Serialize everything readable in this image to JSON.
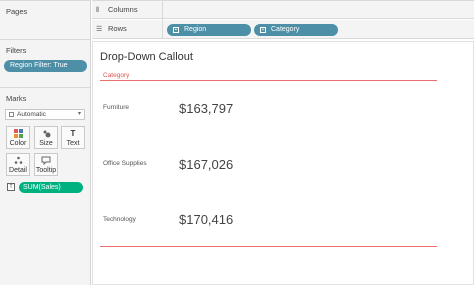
{
  "cards": {
    "pages_title": "Pages",
    "filters_title": "Filters",
    "marks_title": "Marks",
    "filter_pill": "Region Filter: True",
    "mark_type": "Automatic",
    "mark_buttons": {
      "color": "Color",
      "size": "Size",
      "text": "Text",
      "detail": "Detail",
      "tooltip": "Tooltip"
    },
    "measure_pill": "SUM(Sales)"
  },
  "shelves": {
    "columns_label": "Columns",
    "rows_label": "Rows",
    "rows_pills": [
      "Region",
      "Category"
    ]
  },
  "view": {
    "title": "Drop-Down Callout",
    "header": "Category",
    "rows": [
      {
        "label": "Furniture",
        "value": "$163,797"
      },
      {
        "label": "Office Supplies",
        "value": "$167,026"
      },
      {
        "label": "Technology",
        "value": "$170,416"
      }
    ]
  },
  "colors": {
    "dimension_pill": "#4e8fa8",
    "measure_pill": "#00b180",
    "accent_line": "#e86f6b"
  }
}
